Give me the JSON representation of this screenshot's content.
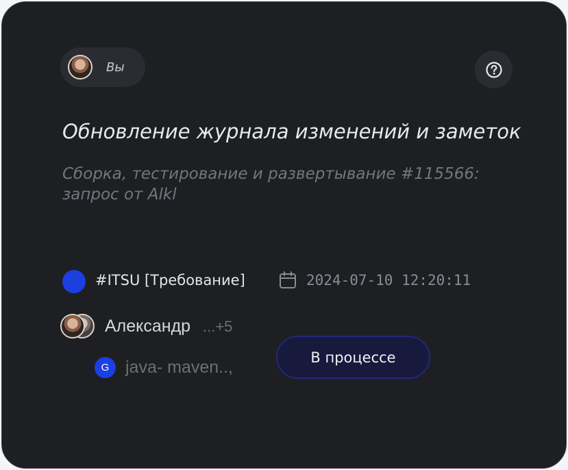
{
  "user": {
    "label": "Вы",
    "avatar_icon": "user-avatar"
  },
  "help": {
    "icon": "question-circle-icon"
  },
  "task": {
    "title": "Обновление журнала изменений и заметок",
    "subtitle": "Сборка, тестирование и развертывание #115566: запрос  от Alkl"
  },
  "category": {
    "label": "#ITSU [Требование]",
    "color": "#1c3fe0"
  },
  "date": {
    "icon": "calendar-icon",
    "value": "2024-07-10 12:20:11"
  },
  "assignees": {
    "name": "Александр",
    "more": "...+5"
  },
  "repo": {
    "badge": "G",
    "name": "java- maven..,",
    "color": "#1c3fe0"
  },
  "status": {
    "label": "В процессе",
    "background": "#171a3d",
    "border": "#23287a"
  },
  "theme": {
    "card_background": "#1d1f23",
    "pill_background": "#2a2c31"
  }
}
